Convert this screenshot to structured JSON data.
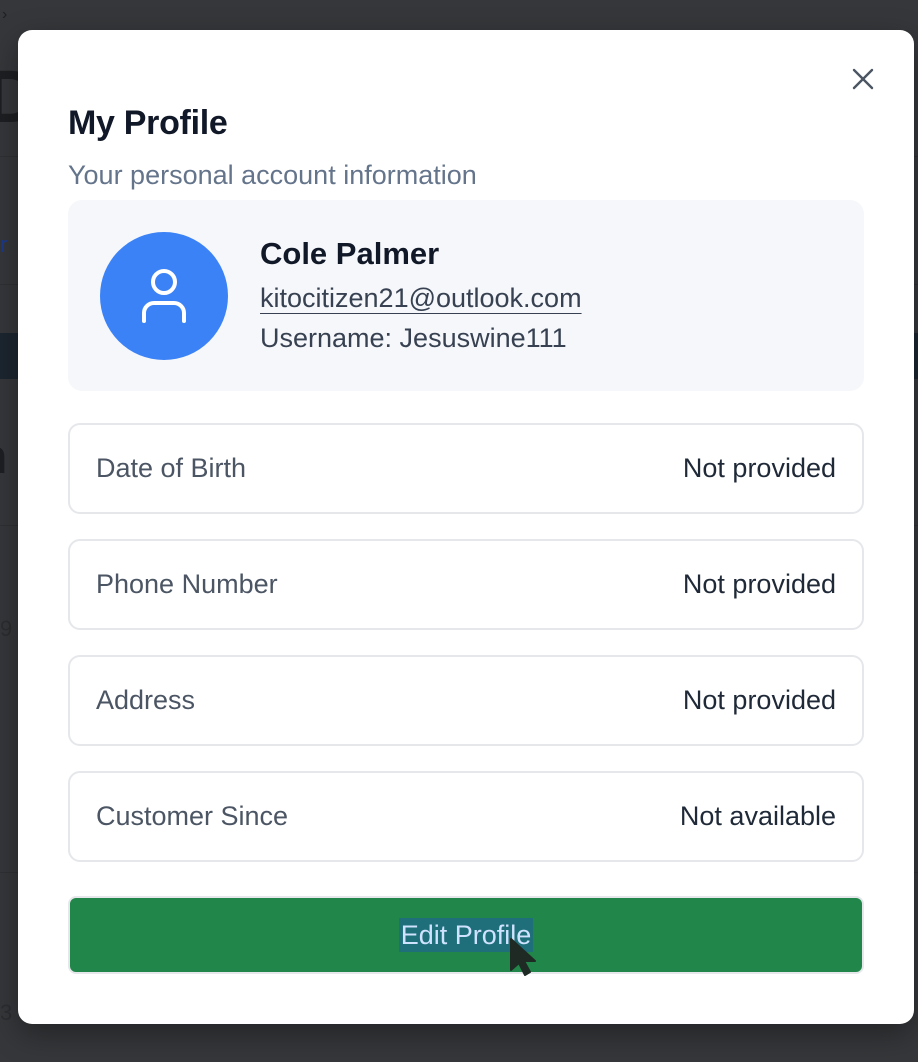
{
  "modal": {
    "title": "My Profile",
    "subtitle": "Your personal account information",
    "close_icon": "close-icon"
  },
  "user": {
    "name": "Cole Palmer",
    "email": "kitocitizen21@outlook.com",
    "username": "Username: Jesuswine111",
    "avatar_icon": "user-icon",
    "avatar_color": "#3b82f6"
  },
  "details": [
    {
      "label": "Date of Birth",
      "value": "Not provided"
    },
    {
      "label": "Phone Number",
      "value": "Not provided"
    },
    {
      "label": "Address",
      "value": "Not provided"
    },
    {
      "label": "Customer Since",
      "value": "Not available"
    }
  ],
  "actions": {
    "edit_label": "Edit Profile",
    "edit_color": "#218649"
  }
}
